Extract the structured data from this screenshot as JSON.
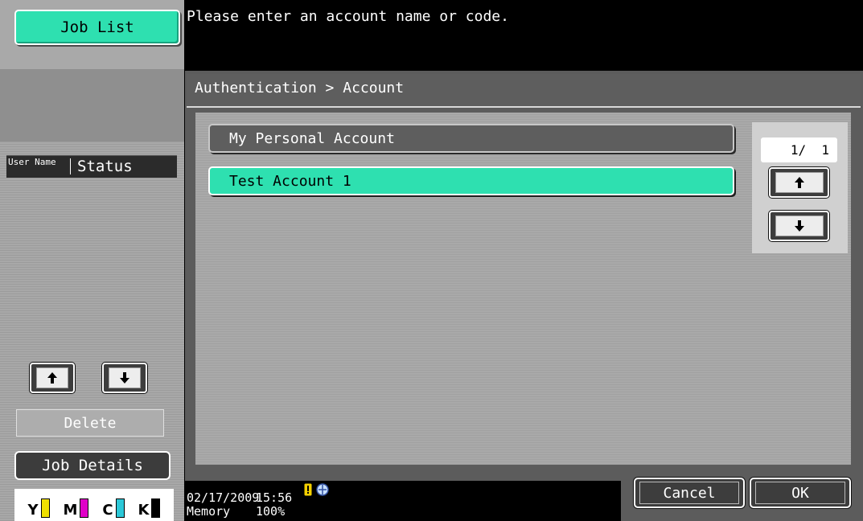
{
  "sidebar": {
    "job_list_label": "Job List",
    "header_user_name": "User Name",
    "header_status": "Status",
    "scroll_up_icon": "arrow-up-icon",
    "scroll_down_icon": "arrow-down-icon",
    "delete_label": "Delete",
    "job_details_label": "Job Details",
    "toner": [
      {
        "letter": "Y",
        "color": "#f0e000"
      },
      {
        "letter": "M",
        "color": "#e000c8"
      },
      {
        "letter": "C",
        "color": "#2cc8d8"
      },
      {
        "letter": "K",
        "color": "#000000"
      }
    ]
  },
  "message": "Please enter an account name or code.",
  "breadcrumb": "Authentication > Account",
  "accounts": [
    {
      "label": "My Personal Account",
      "selected": false
    },
    {
      "label": "Test Account 1",
      "selected": true
    }
  ],
  "pager": {
    "page_indicator": "1/  1",
    "up_icon": "arrow-up-icon",
    "down_icon": "arrow-down-icon"
  },
  "footer": {
    "date": "02/17/2009",
    "time": "15:56",
    "memory_label": "Memory",
    "memory_value": "100%",
    "status_icons": [
      "warning-icon",
      "network-icon"
    ]
  },
  "actions": {
    "cancel_label": "Cancel",
    "ok_label": "OK"
  },
  "colors": {
    "accent": "#2ee0b0",
    "panel_dark": "#5c5c5c",
    "background": "#000000"
  }
}
